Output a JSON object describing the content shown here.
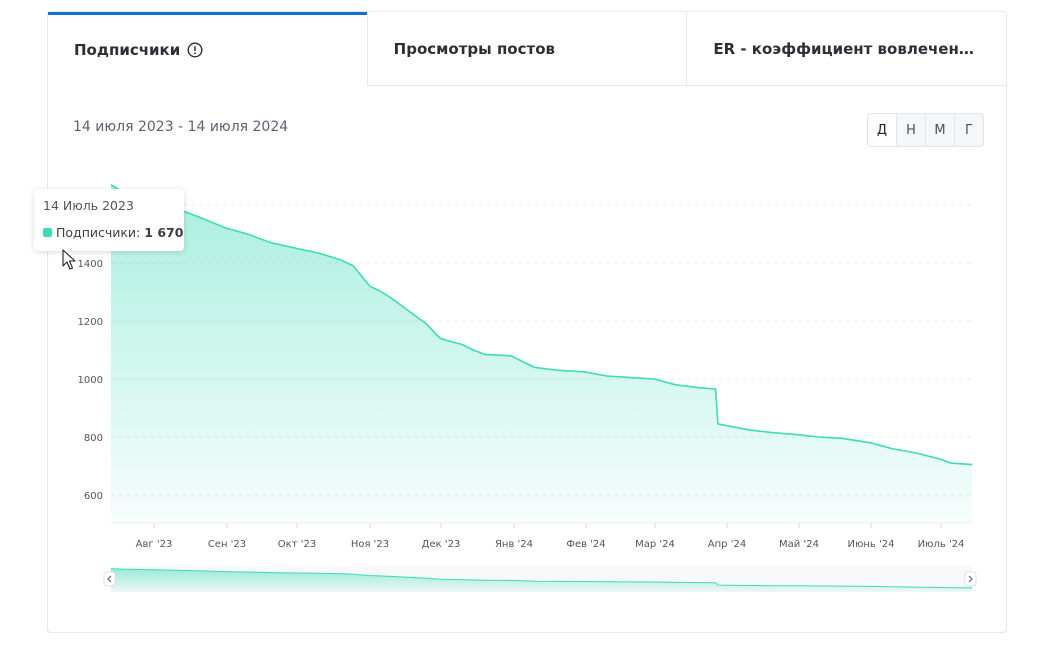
{
  "tabs": [
    {
      "label": "Подписчики",
      "active": true
    },
    {
      "label": "Просмотры постов",
      "active": false
    },
    {
      "label": "ER - коэффициент вовлеченнос…",
      "active": false
    }
  ],
  "date_range": "14 июля 2023 - 14 июля 2024",
  "granularity": [
    "Д",
    "Н",
    "М",
    "Г"
  ],
  "tooltip": {
    "date": "14 Июль 2023",
    "series": "Подписчики:",
    "value": "1 670"
  },
  "colors": {
    "accent": "#1272cc",
    "series": "#3ddbb7"
  },
  "icons": {
    "info": "info-circle-icon",
    "nav_left": "chevron-left-icon",
    "nav_right": "chevron-right-icon"
  },
  "chart_data": {
    "type": "area",
    "x_labels": [
      "Авг '23",
      "Сен '23",
      "Окт '23",
      "Ноя '23",
      "Дек '23",
      "Янв '24",
      "Фев '24",
      "Мар '24",
      "Апр '24",
      "Май '24",
      "Июнь '24",
      "Июль '24"
    ],
    "y_ticks": [
      "600",
      "800",
      "1000",
      "1200",
      "1400"
    ],
    "ylim": [
      500,
      1700
    ],
    "grid": true,
    "series": [
      {
        "name": "Подписчики",
        "points": [
          [
            "2023-07-14",
            1670
          ],
          [
            "2023-07-20",
            1640
          ],
          [
            "2023-07-25",
            1630
          ],
          [
            "2023-08-01",
            1610
          ],
          [
            "2023-08-10",
            1590
          ],
          [
            "2023-08-20",
            1560
          ],
          [
            "2023-09-01",
            1520
          ],
          [
            "2023-09-10",
            1500
          ],
          [
            "2023-09-20",
            1470
          ],
          [
            "2023-10-01",
            1450
          ],
          [
            "2023-10-10",
            1435
          ],
          [
            "2023-10-20",
            1410
          ],
          [
            "2023-10-25",
            1390
          ],
          [
            "2023-11-01",
            1320
          ],
          [
            "2023-11-05",
            1305
          ],
          [
            "2023-11-10",
            1280
          ],
          [
            "2023-11-15",
            1250
          ],
          [
            "2023-11-25",
            1190
          ],
          [
            "2023-12-01",
            1140
          ],
          [
            "2023-12-05",
            1130
          ],
          [
            "2023-12-10",
            1120
          ],
          [
            "2023-12-15",
            1100
          ],
          [
            "2023-12-20",
            1085
          ],
          [
            "2023-12-31",
            1080
          ],
          [
            "2024-01-05",
            1060
          ],
          [
            "2024-01-10",
            1040
          ],
          [
            "2024-01-20",
            1030
          ],
          [
            "2024-01-31",
            1025
          ],
          [
            "2024-02-10",
            1010
          ],
          [
            "2024-02-20",
            1005
          ],
          [
            "2024-03-01",
            1000
          ],
          [
            "2024-03-10",
            980
          ],
          [
            "2024-03-20",
            970
          ],
          [
            "2024-03-27",
            965
          ],
          [
            "2024-03-28",
            845
          ],
          [
            "2024-04-10",
            825
          ],
          [
            "2024-04-20",
            815
          ],
          [
            "2024-05-01",
            808
          ],
          [
            "2024-05-10",
            800
          ],
          [
            "2024-05-20",
            795
          ],
          [
            "2024-06-01",
            780
          ],
          [
            "2024-06-10",
            760
          ],
          [
            "2024-06-20",
            745
          ],
          [
            "2024-06-30",
            725
          ],
          [
            "2024-07-05",
            710
          ],
          [
            "2024-07-14",
            705
          ]
        ]
      }
    ]
  }
}
